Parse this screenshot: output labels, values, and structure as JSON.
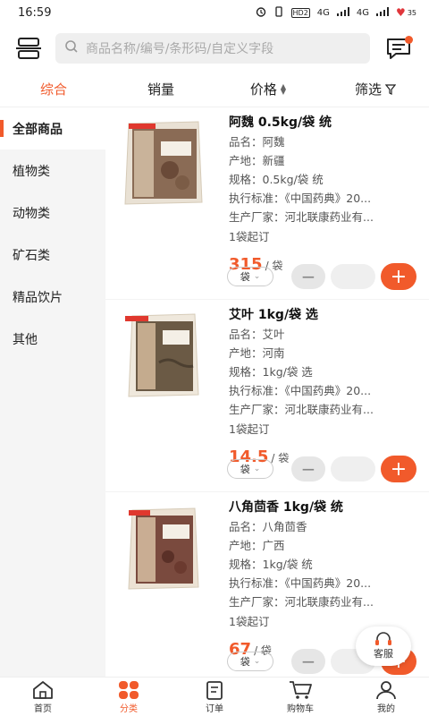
{
  "status_bar": {
    "time": "16:59",
    "battery": "35",
    "network1": "4G",
    "network2": "4G",
    "hd": "HD2"
  },
  "search": {
    "placeholder": "商品名称/编号/条形码/自定义字段"
  },
  "sort_tabs": [
    {
      "label": "综合",
      "active": true
    },
    {
      "label": "销量"
    },
    {
      "label": "价格"
    },
    {
      "label": "筛选"
    }
  ],
  "categories": [
    {
      "label": "全部商品",
      "active": true
    },
    {
      "label": "植物类"
    },
    {
      "label": "动物类"
    },
    {
      "label": "矿石类"
    },
    {
      "label": "精品饮片"
    },
    {
      "label": "其他"
    }
  ],
  "products": [
    {
      "title": "阿魏 0.5kg/袋 统",
      "name_line": "品名：阿魏",
      "origin_line": "产地：新疆",
      "spec_line": "规格：0.5kg/袋 统",
      "standard_line": "执行标准：《中国药典》20...",
      "maker_line": "生产厂家：河北联康药业有...",
      "min_order": "1袋起订",
      "price": "315",
      "price_unit": "/ 袋",
      "unit": "袋"
    },
    {
      "title": "艾叶 1kg/袋 选",
      "name_line": "品名：艾叶",
      "origin_line": "产地：河南",
      "spec_line": "规格：1kg/袋 选",
      "standard_line": "执行标准：《中国药典》20...",
      "maker_line": "生产厂家：河北联康药业有...",
      "min_order": "1袋起订",
      "price": "14.5",
      "price_unit": "/ 袋",
      "unit": "袋"
    },
    {
      "title": "八角茴香 1kg/袋 统",
      "name_line": "品名：八角茴香",
      "origin_line": "产地：广西",
      "spec_line": "规格：1kg/袋 统",
      "standard_line": "执行标准：《中国药典》20...",
      "maker_line": "生产厂家：河北联康药业有...",
      "min_order": "1袋起订",
      "price": "67",
      "price_unit": "/ 袋",
      "unit": "袋"
    }
  ],
  "customer_service": {
    "label": "客服"
  },
  "bottom_nav": [
    {
      "label": "首页",
      "icon": "home-icon"
    },
    {
      "label": "分类",
      "icon": "category-icon",
      "active": true
    },
    {
      "label": "订单",
      "icon": "order-icon"
    },
    {
      "label": "购物车",
      "icon": "cart-icon"
    },
    {
      "label": "我的",
      "icon": "profile-icon"
    }
  ],
  "colors": {
    "accent": "#f15a2b",
    "sidebar_bg": "#f5f5f5"
  }
}
